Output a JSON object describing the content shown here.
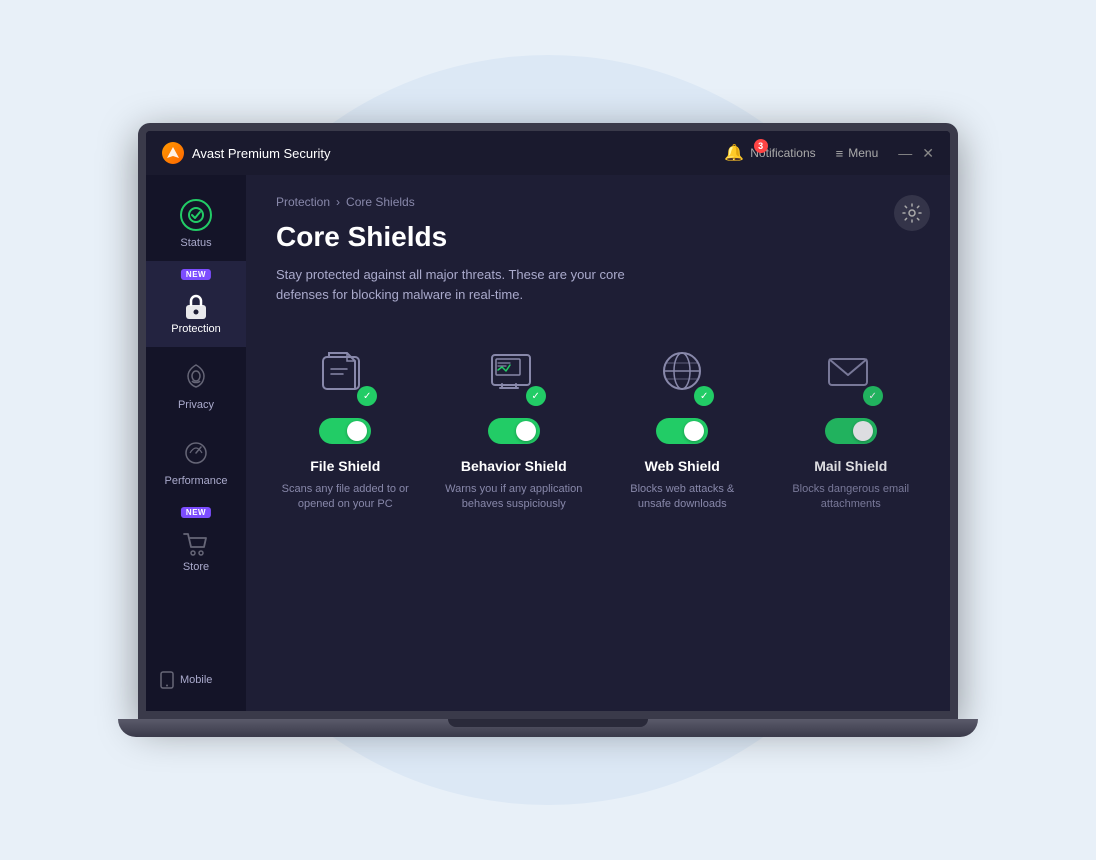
{
  "bg": {
    "circle_color": "#dce8f5"
  },
  "titlebar": {
    "logo_letter": "a",
    "app_name": "Avast Premium Security",
    "notifications_label": "Notifications",
    "notifications_count": "3",
    "menu_label": "Menu",
    "minimize": "—",
    "close": "✕"
  },
  "sidebar": {
    "items": [
      {
        "id": "status",
        "label": "Status",
        "icon": "check-circle",
        "active": false,
        "new": false
      },
      {
        "id": "protection",
        "label": "Protection",
        "icon": "lock",
        "active": true,
        "new": true
      },
      {
        "id": "privacy",
        "label": "Privacy",
        "icon": "fingerprint",
        "active": false,
        "new": false
      },
      {
        "id": "performance",
        "label": "Performance",
        "icon": "speedometer",
        "active": false,
        "new": false
      },
      {
        "id": "store",
        "label": "Store",
        "icon": "cart",
        "active": false,
        "new": true
      }
    ],
    "mobile_label": "Mobile",
    "new_badge": "NEW"
  },
  "content": {
    "breadcrumb_parent": "Protection",
    "breadcrumb_sep": "›",
    "breadcrumb_current": "Core Shields",
    "page_title": "Core Shields",
    "page_subtitle": "Stay protected against all major threats. These are your core defenses for blocking malware in real-time.",
    "shields": [
      {
        "id": "file-shield",
        "icon": "folder",
        "name": "File Shield",
        "description": "Scans any file added to or opened on your PC",
        "enabled": true
      },
      {
        "id": "behavior-shield",
        "icon": "monitor-check",
        "name": "Behavior Shield",
        "description": "Warns you if any application behaves suspiciously",
        "enabled": true
      },
      {
        "id": "web-shield",
        "icon": "globe-shield",
        "name": "Web Shield",
        "description": "Blocks web attacks & unsafe downloads",
        "enabled": true
      },
      {
        "id": "mail-shield",
        "icon": "mail",
        "name": "Mail Shield",
        "description": "Blocks dangerous email attachments",
        "enabled": true
      }
    ]
  }
}
